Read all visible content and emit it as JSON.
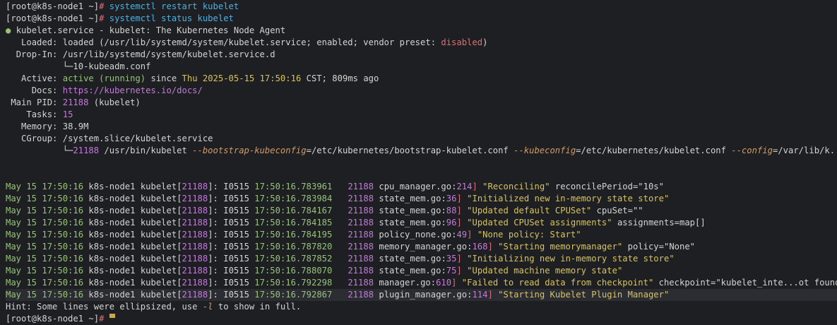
{
  "prompt": {
    "text": "[root@k8s-node1 ~]",
    "hash": "#"
  },
  "commands": [
    "systemctl restart kubelet",
    "systemctl status kubelet"
  ],
  "status": {
    "dot": "●",
    "title": "kubelet.service - kubelet: The Kubernetes Node Agent",
    "loaded_label": "Loaded:",
    "loaded_pre": "loaded (/usr/lib/systemd/system/kubelet.service; enabled; vendor preset: ",
    "loaded_disabled": "disabled",
    "loaded_post": ")",
    "dropin_label": "Drop-In:",
    "dropin_path": "/usr/lib/systemd/system/kubelet.service.d",
    "dropin_file": "└─10-kubeadm.conf",
    "active_label": "Active:",
    "active_state": "active (running)",
    "active_since": " since ",
    "active_date": "Thu 2025-05-15 17:50:16",
    "active_post": " CST; 809ms ago",
    "docs_label": "Docs:",
    "docs_url": "https://kubernetes.io/docs/",
    "pid_label": "Main PID:",
    "pid_num": "21188",
    "pid_name": " (kubelet)",
    "tasks_label": "Tasks:",
    "tasks_val": "15",
    "memory_label": "Memory:",
    "memory_val": "38.9M",
    "cgroup_label": "CGroup:",
    "cgroup_val": "/system.slice/kubelet.service",
    "cgroup_tree": "└─",
    "cgroup_pid": "21188",
    "cgroup_cmd1": " /usr/bin/kubelet ",
    "flag1": "--bootstrap-kubeconfig",
    "val1": "=/etc/kubernetes/bootstrap-kubelet.conf ",
    "flag2": "--kubeconfig",
    "val2": "=/etc/kubernetes/kubelet.conf ",
    "flag3": "--config",
    "val3": "=/var/lib/k..."
  },
  "log": [
    {
      "date": "May 15",
      "time": "17:50:16",
      "host": "k8s-node1",
      "svc": "kubelet",
      "pid": "21188",
      "level": "I0515",
      "ts": "17:50:16.783961",
      "tid": "21188",
      "file": "cpu_manager.go",
      "line": "214",
      "msg": "\"Reconciling\"",
      "extra": " reconcilePeriod=\"10s\""
    },
    {
      "date": "May 15",
      "time": "17:50:16",
      "host": "k8s-node1",
      "svc": "kubelet",
      "pid": "21188",
      "level": "I0515",
      "ts": "17:50:16.783984",
      "tid": "21188",
      "file": "state_mem.go",
      "line": "36",
      "msg": "\"Initialized new in-memory state store\"",
      "extra": ""
    },
    {
      "date": "May 15",
      "time": "17:50:16",
      "host": "k8s-node1",
      "svc": "kubelet",
      "pid": "21188",
      "level": "I0515",
      "ts": "17:50:16.784167",
      "tid": "21188",
      "file": "state_mem.go",
      "line": "88",
      "msg": "\"Updated default CPUSet\"",
      "extra": " cpuSet=\"\""
    },
    {
      "date": "May 15",
      "time": "17:50:16",
      "host": "k8s-node1",
      "svc": "kubelet",
      "pid": "21188",
      "level": "I0515",
      "ts": "17:50:16.784185",
      "tid": "21188",
      "file": "state_mem.go",
      "line": "96",
      "msg": "\"Updated CPUSet assignments\"",
      "extra": " assignments=map[]"
    },
    {
      "date": "May 15",
      "time": "17:50:16",
      "host": "k8s-node1",
      "svc": "kubelet",
      "pid": "21188",
      "level": "I0515",
      "ts": "17:50:16.784195",
      "tid": "21188",
      "file": "policy_none.go",
      "line": "49",
      "msg": "\"None policy: Start\"",
      "extra": ""
    },
    {
      "date": "May 15",
      "time": "17:50:16",
      "host": "k8s-node1",
      "svc": "kubelet",
      "pid": "21188",
      "level": "I0515",
      "ts": "17:50:16.787820",
      "tid": "21188",
      "file": "memory_manager.go",
      "line": "168",
      "msg": "\"Starting memorymanager\"",
      "extra": " policy=\"None\""
    },
    {
      "date": "May 15",
      "time": "17:50:16",
      "host": "k8s-node1",
      "svc": "kubelet",
      "pid": "21188",
      "level": "I0515",
      "ts": "17:50:16.787852",
      "tid": "21188",
      "file": "state_mem.go",
      "line": "35",
      "msg": "\"Initializing new in-memory state store\"",
      "extra": ""
    },
    {
      "date": "May 15",
      "time": "17:50:16",
      "host": "k8s-node1",
      "svc": "kubelet",
      "pid": "21188",
      "level": "I0515",
      "ts": "17:50:16.788070",
      "tid": "21188",
      "file": "state_mem.go",
      "line": "75",
      "msg": "\"Updated machine memory state\"",
      "extra": ""
    },
    {
      "date": "May 15",
      "time": "17:50:16",
      "host": "k8s-node1",
      "svc": "kubelet",
      "pid": "21188",
      "level": "I0515",
      "ts": "17:50:16.792298",
      "tid": "21188",
      "file": "manager.go",
      "line": "610",
      "msg": "\"Failed to read data from checkpoint\"",
      "extra": " checkpoint=\"kubelet_inte...ot found\""
    },
    {
      "date": "May 15",
      "time": "17:50:16",
      "host": "k8s-node1",
      "svc": "kubelet",
      "pid": "21188",
      "level": "I0515",
      "ts": "17:50:16.792867",
      "tid": "21188",
      "file": "plugin_manager.go",
      "line": "114",
      "msg": "\"Starting Kubelet Plugin Manager\"",
      "extra": ""
    }
  ],
  "hint": {
    "pre": "Hint: Some lines were ellipsized, use ",
    "flag": "-l",
    "post": " to show in full."
  }
}
